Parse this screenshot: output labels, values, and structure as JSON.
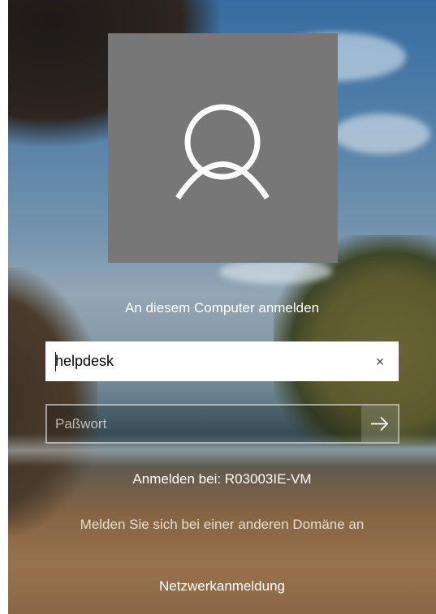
{
  "login": {
    "title": "An diesem Computer anmelden",
    "username": {
      "value": "helpdesk",
      "clear_icon": "×"
    },
    "password": {
      "placeholder": "Paßwort",
      "submit_icon": "arrow-right-icon"
    },
    "signin_to": "Anmelden bei: R03003IE-VM",
    "other_domain": "Melden Sie sich bei einer anderen Domäne an",
    "network_signin": "Netzwerkanmeldung"
  },
  "colors": {
    "avatar_bg": "#777777",
    "text": "#ffffff"
  }
}
